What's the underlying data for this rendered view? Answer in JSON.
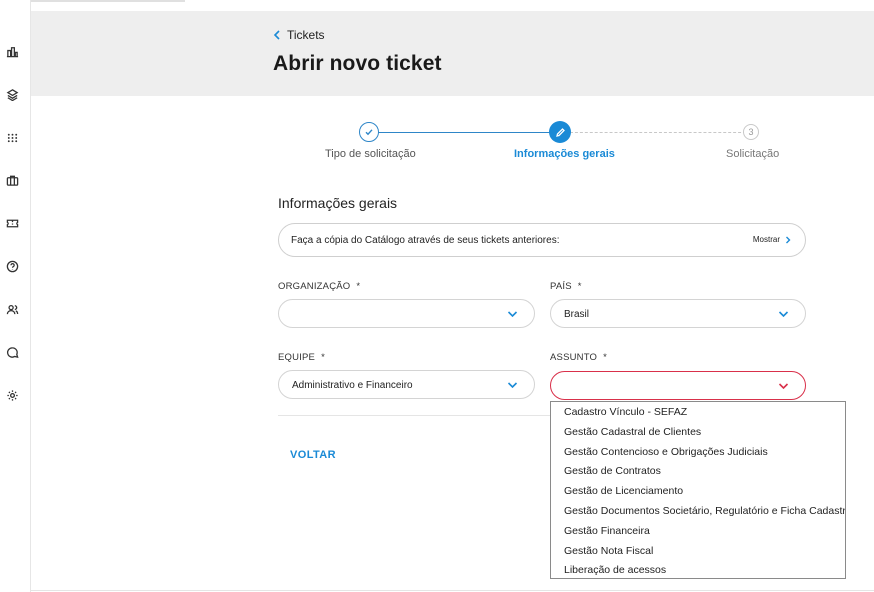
{
  "sidebar": {
    "icons": [
      "dashboard-icon",
      "layers-icon",
      "apps-grid-icon",
      "briefcase-icon",
      "ticket-icon",
      "help-icon",
      "users-icon",
      "chat-icon",
      "settings-icon"
    ]
  },
  "header": {
    "breadcrumb": "Tickets",
    "title": "Abrir novo ticket"
  },
  "stepper": {
    "steps": [
      {
        "label": "Tipo de solicitação",
        "state": "done"
      },
      {
        "label": "Informações gerais",
        "state": "active"
      },
      {
        "label": "Solicitação",
        "state": "pending",
        "number": "3"
      }
    ]
  },
  "form": {
    "section_title": "Informações gerais",
    "catalog_text": "Faça a cópia do Catálogo através de seus tickets anteriores:",
    "catalog_action": "Mostrar",
    "organizacao_label": "ORGANIZAÇÃO",
    "organizacao_value": "",
    "pais_label": "PAÍS",
    "pais_value": "Brasil",
    "equipe_label": "EQUIPE",
    "equipe_value": "Administrativo e Financeiro",
    "assunto_label": "ASSUNTO",
    "assunto_value": "",
    "required_mark": "*",
    "back_label": "VOLTAR"
  },
  "assunto_options": [
    "Cadastro Vínculo - SEFAZ",
    "Gestão Cadastral de Clientes",
    "Gestão Contencioso e Obrigações Judiciais",
    "Gestão de Contratos",
    "Gestão de Licenciamento",
    "Gestão Documentos Societário, Regulatório e Ficha Cadastral",
    "Gestão Financeira",
    "Gestão Nota Fiscal",
    "Liberação de acessos"
  ],
  "colors": {
    "accent": "#1a8ad6",
    "error": "#d9304a",
    "header_bg": "#eeeeee"
  }
}
